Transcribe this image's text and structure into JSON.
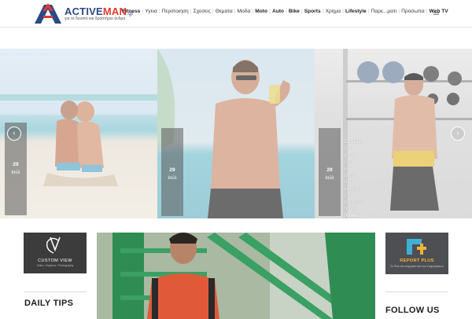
{
  "brand": {
    "name_part1": "ACTIVE",
    "name_part2": "MAN",
    "domain_suffix": ".gr",
    "tagline": "για το δυνατό και δραστήριο άνδρα"
  },
  "nav": {
    "items": [
      {
        "label": "Fitness",
        "bold": true
      },
      {
        "label": "Υγεια",
        "bold": false
      },
      {
        "label": "Περιποιηση",
        "bold": false
      },
      {
        "label": "Σχεσεις",
        "bold": false
      },
      {
        "label": "Θεματα",
        "bold": false
      },
      {
        "label": "Μοδα",
        "bold": false
      },
      {
        "label": "Moto",
        "bold": true
      },
      {
        "label": "Auto",
        "bold": true
      },
      {
        "label": "Bike",
        "bold": true
      },
      {
        "label": "Sports",
        "bold": true
      },
      {
        "label": "Χρημα",
        "bold": false
      },
      {
        "label": "Lifestyle",
        "bold": true
      },
      {
        "label": "Παρε...ματι",
        "bold": false
      },
      {
        "label": "Προσωπα",
        "bold": false
      },
      {
        "label": "Web TV",
        "bold": true
      }
    ],
    "menu_icon": "hamburger-icon"
  },
  "slider": {
    "slides": [
      {
        "day": "29",
        "month": "Ιούλ",
        "caption": []
      },
      {
        "day": "29",
        "month": "Ιούλ",
        "caption": []
      },
      {
        "day": "29",
        "month": "Ιούλ",
        "caption": [
          "Στενέψε",
          "τον",
          "γοφό",
          "σου",
          "με",
          "αυτή",
          "την",
          "άσκηση",
          "στο",
          "ταχύτερο",
          "πάνω"
        ],
        "video_tag": "(Video)"
      }
    ],
    "prev_icon": "chevron-left-icon",
    "next_icon": "chevron-right-icon"
  },
  "ads": {
    "left": {
      "label": "CUSTOM VIEW",
      "sub": "Video. Graphics. Photography"
    },
    "right": {
      "label": "REPORT PLUS",
      "sub": "Το Plus του επιχειρείν και των επιχειρήσεων"
    }
  },
  "sections": {
    "daily_tips": "DAILY TIPS",
    "follow_us": "FOLLOW US"
  },
  "colors": {
    "brand_blue": "#2b4a86",
    "brand_red": "#e23a2e",
    "report_orange": "#f0b53b"
  }
}
